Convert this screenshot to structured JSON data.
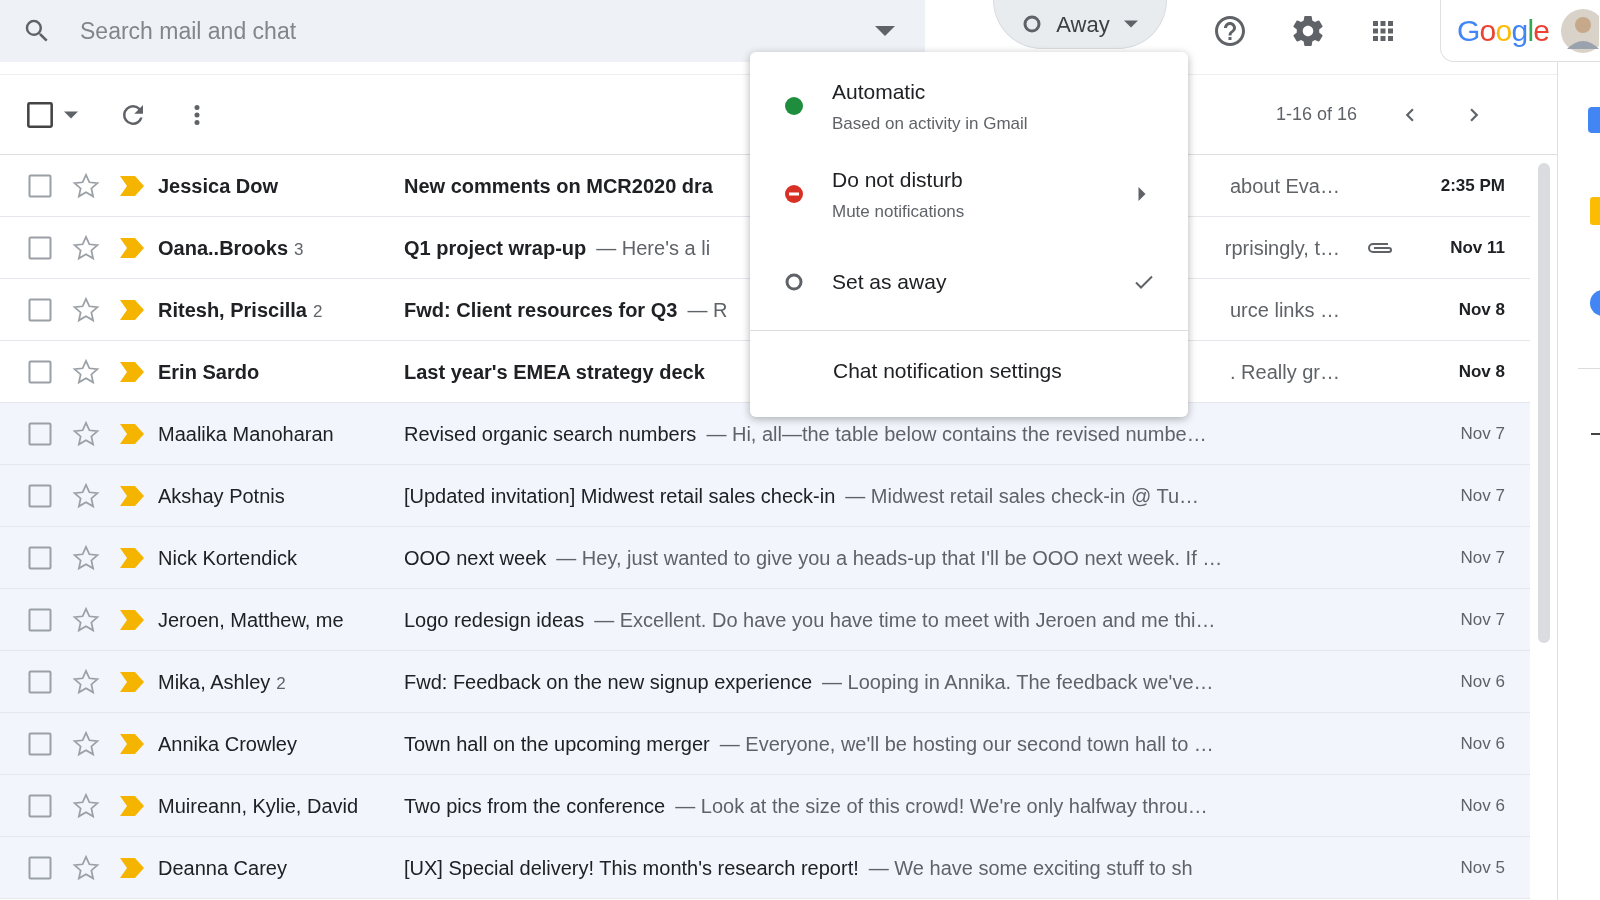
{
  "search": {
    "placeholder": "Search mail and chat"
  },
  "status_chip": {
    "label": "Away"
  },
  "logo": "Google",
  "toolbar": {
    "select_all": {
      "checked": false
    },
    "pagination": "1-16 of 16"
  },
  "status_menu": {
    "items": [
      {
        "kind": "dot",
        "label": "Automatic",
        "sublabel": "Based on activity in Gmail",
        "color": "#1e8e3e",
        "selected": false,
        "submenu": false
      },
      {
        "kind": "blocked",
        "label": "Do not disturb",
        "sublabel": "Mute notifications",
        "color": "#d93025",
        "selected": false,
        "submenu": true
      },
      {
        "kind": "ring",
        "label": "Set as away",
        "color": "#5f6368",
        "selected": true,
        "submenu": false
      }
    ],
    "settings": "Chat notification settings"
  },
  "emails": [
    {
      "checked": false,
      "starred": false,
      "important": true,
      "unread": true,
      "sender": "Jessica Dow",
      "subject": "New comments on MCR2020 dra",
      "tail": "about Eva…",
      "date": "2:35 PM",
      "attachment": false
    },
    {
      "checked": false,
      "starred": false,
      "important": true,
      "unread": true,
      "sender": "Oana..Brooks",
      "count": "3",
      "subject": "Q1 project wrap-up",
      "snippet": "— Here's a li",
      "tail": "rprisingly, t…",
      "date": "Nov 11",
      "attachment": true
    },
    {
      "checked": false,
      "starred": false,
      "important": true,
      "unread": true,
      "sender": "Ritesh, Priscilla",
      "count": "2",
      "subject": "Fwd: Client resources for Q3",
      "snippet": "— R",
      "tail": "urce links …",
      "date": "Nov 8",
      "attachment": false
    },
    {
      "checked": false,
      "starred": false,
      "important": true,
      "unread": true,
      "sender": "Erin Sardo",
      "subject": "Last year's EMEA strategy deck",
      "tail": ". Really gr…",
      "date": "Nov 8",
      "attachment": false
    },
    {
      "checked": false,
      "starred": false,
      "important": true,
      "unread": false,
      "sender": "Maalika Manoharan",
      "subject": "Revised organic search numbers",
      "snippet": "— Hi, all—the table below contains the revised numbe…",
      "date": "Nov 7",
      "attachment": false
    },
    {
      "checked": false,
      "starred": false,
      "important": true,
      "unread": false,
      "sender": "Akshay Potnis",
      "subject": "[Updated invitation] Midwest retail sales check-in",
      "snippet": "— Midwest retail sales check-in @ Tu…",
      "date": "Nov 7",
      "attachment": false
    },
    {
      "checked": false,
      "starred": false,
      "important": true,
      "unread": false,
      "sender": "Nick Kortendick",
      "subject": "OOO next week",
      "snippet": "— Hey, just wanted to give you a heads-up that I'll be OOO next week. If …",
      "date": "Nov 7",
      "attachment": false
    },
    {
      "checked": false,
      "starred": false,
      "important": true,
      "unread": false,
      "sender": "Jeroen, Matthew, me",
      "subject": "Logo redesign ideas",
      "snippet": "— Excellent. Do have you have time to meet with Jeroen and me thi…",
      "date": "Nov 7",
      "attachment": false
    },
    {
      "checked": false,
      "starred": false,
      "important": true,
      "unread": false,
      "sender": "Mika, Ashley",
      "count": "2",
      "subject": "Fwd: Feedback on the new signup experience",
      "snippet": "— Looping in Annika. The feedback we've…",
      "date": "Nov 6",
      "attachment": false
    },
    {
      "checked": false,
      "starred": false,
      "important": true,
      "unread": false,
      "sender": "Annika Crowley",
      "subject": "Town hall on the upcoming merger",
      "snippet": "— Everyone, we'll be hosting our second town hall to …",
      "date": "Nov 6",
      "attachment": false
    },
    {
      "checked": false,
      "starred": false,
      "important": true,
      "unread": false,
      "sender": "Muireann, Kylie, David",
      "subject": "Two pics from the conference",
      "snippet": "— Look at the size of this crowd! We're only halfway throu…",
      "date": "Nov 6",
      "attachment": false
    },
    {
      "checked": false,
      "starred": false,
      "important": true,
      "unread": false,
      "sender": "Deanna Carey",
      "subject": "[UX] Special delivery! This month's research report!",
      "snippet": "— We have some exciting stuff to sh",
      "date": "Nov 5",
      "attachment": false
    }
  ]
}
